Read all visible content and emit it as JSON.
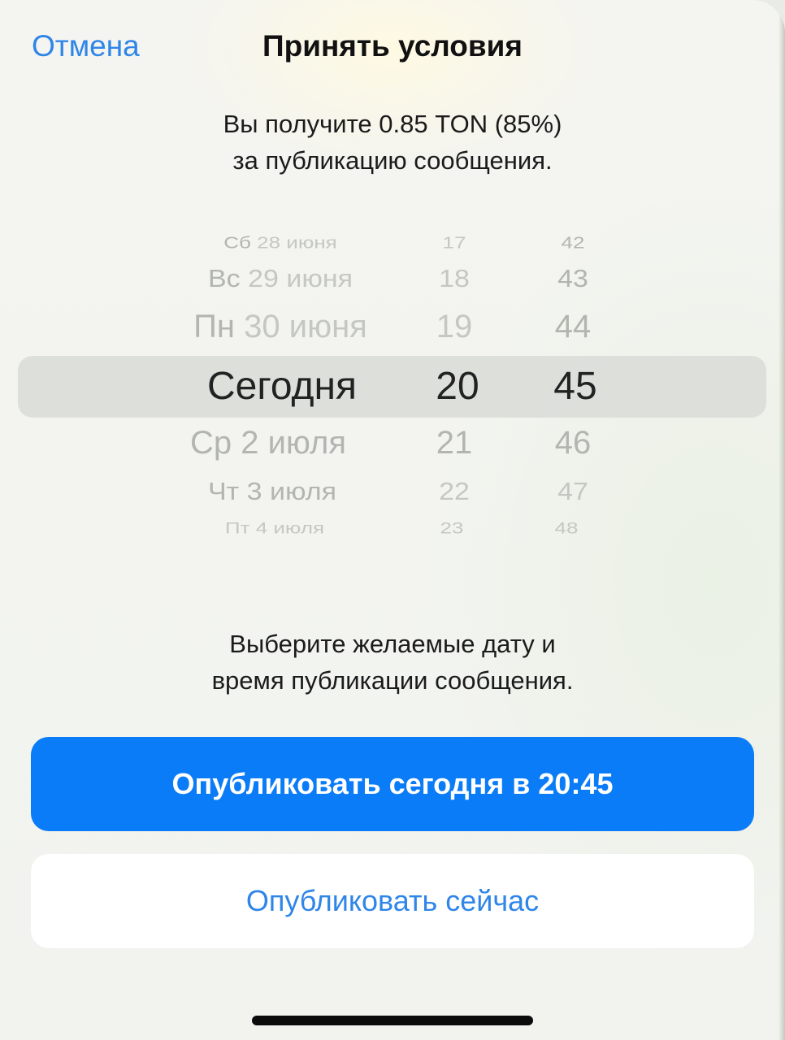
{
  "header": {
    "cancel_label": "Отмена",
    "title": "Принять условия"
  },
  "subtitle": {
    "line1": "Вы получите 0.85 TON (85%)",
    "line2": "за публикацию сообщения."
  },
  "picker": {
    "rows": [
      {
        "day": "Сб",
        "date": "28 июня",
        "hour": "17",
        "minute": "42"
      },
      {
        "day": "Вс",
        "date": "29 июня",
        "hour": "18",
        "minute": "43"
      },
      {
        "day": "Пн",
        "date": "30 июня",
        "hour": "19",
        "minute": "44"
      },
      {
        "day": "",
        "date": "Сегодня",
        "hour": "20",
        "minute": "45"
      },
      {
        "day": "Ср",
        "date": "2 июля",
        "hour": "21",
        "minute": "46"
      },
      {
        "day": "Чт",
        "date": "3 июля",
        "hour": "22",
        "minute": "47"
      },
      {
        "day": "Пт",
        "date": "4 июля",
        "hour": "23",
        "minute": "48"
      }
    ]
  },
  "hint": {
    "line1": "Выберите желаемые дату и",
    "line2": "время публикации сообщения."
  },
  "buttons": {
    "publish_scheduled": "Опубликовать сегодня в 20:45",
    "publish_now": "Опубликовать сейчас"
  },
  "colors": {
    "accent": "#0a7cf7",
    "link": "#2f86e8"
  }
}
